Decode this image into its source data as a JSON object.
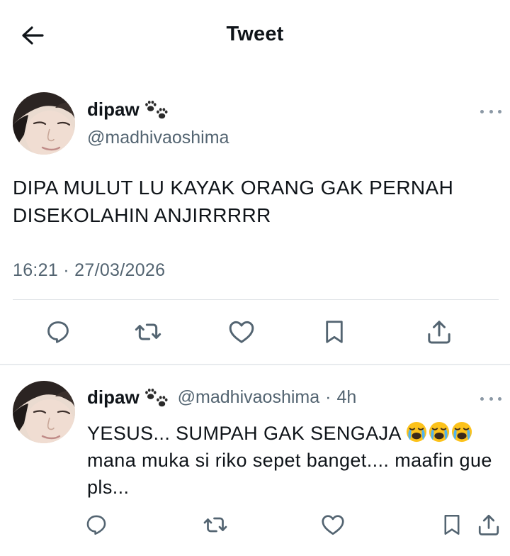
{
  "header": {
    "back_icon": "arrow-left-icon",
    "title": "Tweet"
  },
  "main_tweet": {
    "author_name": "dipaw",
    "author_emoji": "paw-prints-icon",
    "handle": "@madhivaoshima",
    "text": "DIPA MULUT LU KAYAK ORANG GAK PERNAH DISEKOLAHIN ANJIRRRRR",
    "timestamp": "16:21 · 27/03/2026",
    "actions": [
      "reply-icon",
      "retweet-icon",
      "like-icon",
      "bookmark-icon",
      "share-icon"
    ]
  },
  "reply_tweet": {
    "author_name": "dipaw",
    "author_emoji": "paw-prints-icon",
    "handle": "@madhivaoshima",
    "separator": "·",
    "time": "4h",
    "text_line1": "YESUS... SUMPAH GAK SENGAJA",
    "text_emojis": [
      "loudly-crying-face",
      "loudly-crying-face",
      "loudly-crying-face"
    ],
    "text_rest": "mana muka si riko sepet banget.... maafin gue pls...",
    "actions": [
      "reply-icon",
      "retweet-icon",
      "like-icon",
      "bookmark-icon",
      "share-icon"
    ]
  },
  "colors": {
    "text_primary": "#0f1419",
    "text_secondary": "#536471",
    "icon": "#536471",
    "divider": "#dfe3e7"
  }
}
